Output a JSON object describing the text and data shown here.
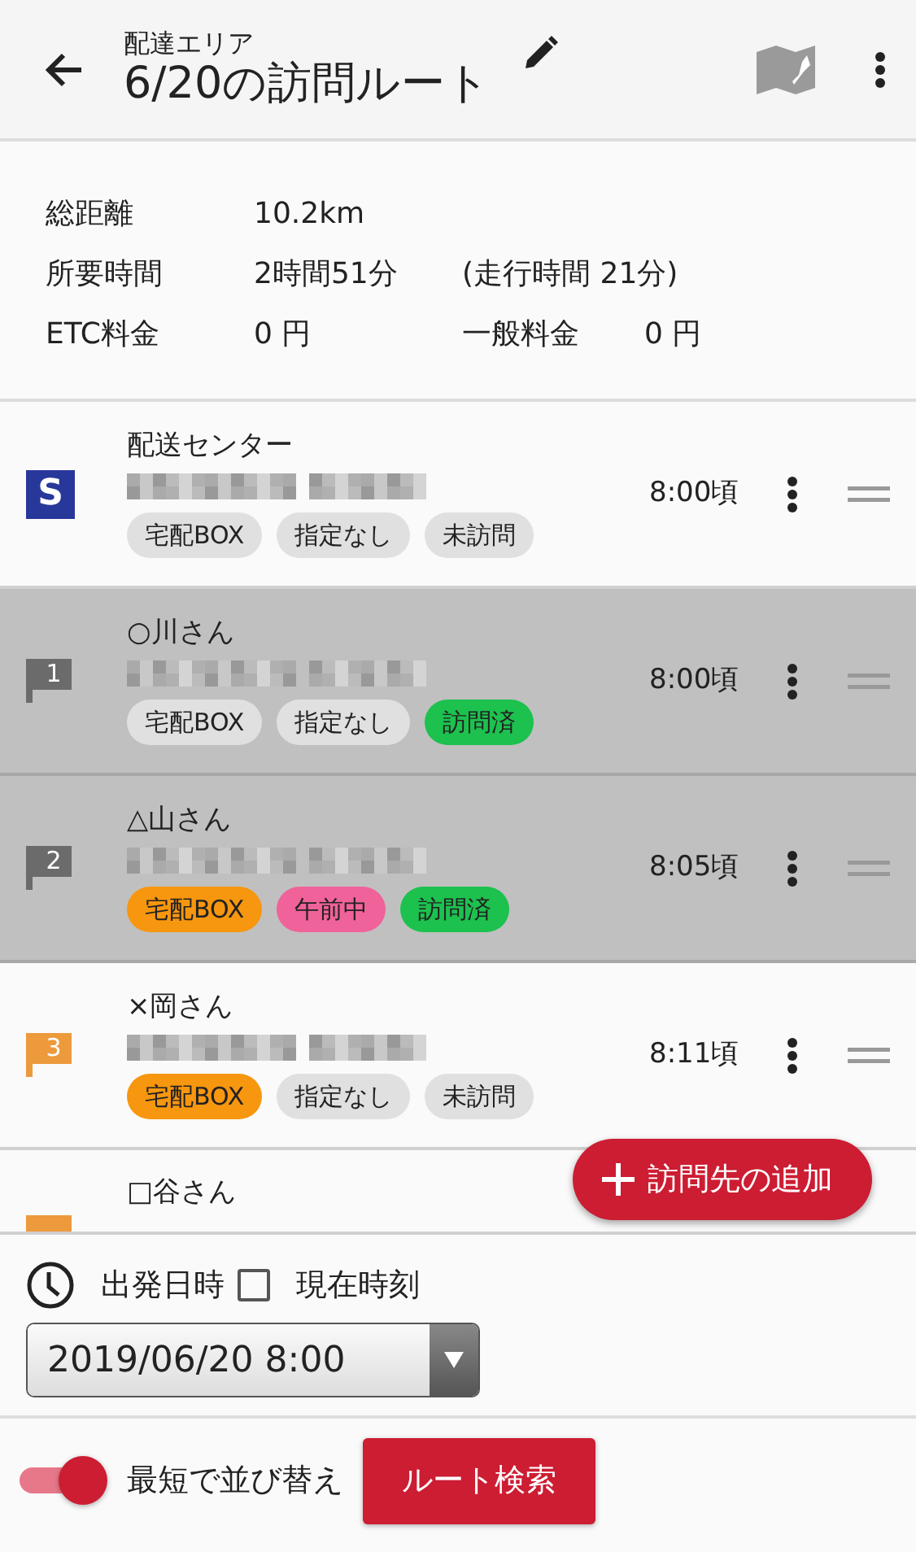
{
  "header": {
    "subtitle": "配達エリア",
    "title": "6/20の訪問ルート"
  },
  "summary": {
    "rows": [
      {
        "label": "総距離",
        "value": "10.2km"
      },
      {
        "label": "所要時間",
        "value": "2時間51分",
        "extra": "(走行時間 21分)"
      },
      {
        "label": "ETC料金",
        "value": "0 円",
        "extra_label": "一般料金",
        "extra_value": "0 円"
      }
    ]
  },
  "stops": [
    {
      "kind": "start",
      "marker": "S",
      "color": "#28389a",
      "name": "配送センター",
      "time": "8:00頃",
      "visited": false,
      "tags": [
        {
          "label": "宅配BOX",
          "color": "#e0e0e0"
        },
        {
          "label": "指定なし",
          "color": "#e0e0e0"
        },
        {
          "label": "未訪問",
          "color": "#e0e0e0"
        }
      ]
    },
    {
      "kind": "stop",
      "marker": "1",
      "color": "#6b6b6b",
      "name": "○川さん",
      "time": "8:00頃",
      "visited": true,
      "tags": [
        {
          "label": "宅配BOX",
          "color": "#e0e0e0"
        },
        {
          "label": "指定なし",
          "color": "#e0e0e0"
        },
        {
          "label": "訪問済",
          "color": "#1cc14e"
        }
      ]
    },
    {
      "kind": "stop",
      "marker": "2",
      "color": "#6b6b6b",
      "name": "△山さん",
      "time": "8:05頃",
      "visited": true,
      "tags": [
        {
          "label": "宅配BOX",
          "color": "#f7960f"
        },
        {
          "label": "午前中",
          "color": "#f0629a"
        },
        {
          "label": "訪問済",
          "color": "#1cc14e"
        }
      ]
    },
    {
      "kind": "stop",
      "marker": "3",
      "color": "#ec9a3c",
      "name": "×岡さん",
      "time": "8:11頃",
      "visited": false,
      "tags": [
        {
          "label": "宅配BOX",
          "color": "#f7960f"
        },
        {
          "label": "指定なし",
          "color": "#e0e0e0"
        },
        {
          "label": "未訪問",
          "color": "#e0e0e0"
        }
      ]
    },
    {
      "kind": "partial",
      "color": "#ec9a3c",
      "name": "□谷さん",
      "visited": false
    }
  ],
  "add_button": {
    "label": "訪問先の追加"
  },
  "departure": {
    "label": "出発日時",
    "now_label": "現在時刻",
    "now_checked": false,
    "value": "2019/06/20 8:00"
  },
  "footer": {
    "sort_label": "最短で並び替え",
    "sort_on": true,
    "search_button": "ルート検索"
  }
}
